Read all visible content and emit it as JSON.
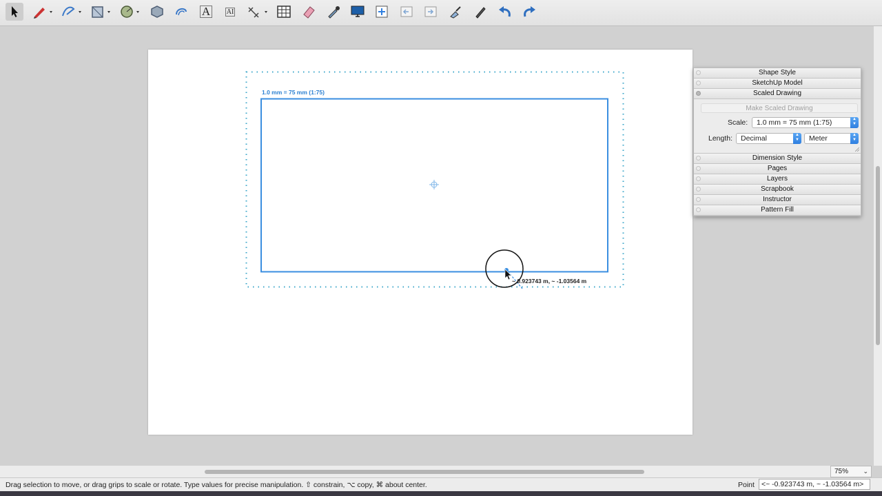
{
  "toolbar": {
    "tools": [
      {
        "id": "select",
        "icon": "arrow-select-icon",
        "active": true
      },
      {
        "id": "freehand",
        "icon": "pencil-freehand-icon"
      },
      {
        "id": "lines",
        "icon": "bezier-line-icon"
      },
      {
        "id": "rectangle",
        "icon": "rectangle-icon"
      },
      {
        "id": "circle",
        "icon": "circle-icon"
      },
      {
        "id": "polygon",
        "icon": "polygon-icon"
      },
      {
        "id": "offset",
        "icon": "offset-icon"
      },
      {
        "id": "text",
        "icon": "text-icon",
        "glyph": "A"
      },
      {
        "id": "label",
        "icon": "label-text-icon",
        "glyph": "AI"
      },
      {
        "id": "dimension",
        "icon": "dimension-icon"
      },
      {
        "id": "table",
        "icon": "table-icon"
      },
      {
        "id": "eraser",
        "icon": "eraser-icon"
      },
      {
        "id": "eyedropper",
        "icon": "eyedropper-icon"
      },
      {
        "id": "presentation",
        "icon": "monitor-icon"
      },
      {
        "id": "add-page",
        "icon": "add-page-icon"
      },
      {
        "id": "previous-page",
        "icon": "previous-page-icon"
      },
      {
        "id": "next-page",
        "icon": "next-page-icon"
      },
      {
        "id": "style",
        "icon": "style-brush-icon"
      },
      {
        "id": "pen",
        "icon": "pen-icon"
      },
      {
        "id": "undo",
        "icon": "undo-icon"
      },
      {
        "id": "redo",
        "icon": "redo-icon"
      }
    ]
  },
  "drawing": {
    "scale_label": "1.0 mm = 75 mm (1:75)",
    "coordinate_tooltip": "~ 0.923743 m, ~ -1.03564 m",
    "selection_color": "#2a7fd1"
  },
  "inspector": {
    "panels": [
      {
        "label": "Shape Style"
      },
      {
        "label": "SketchUp Model"
      },
      {
        "label": "Scaled Drawing",
        "open": true
      },
      {
        "label": "Dimension Style"
      },
      {
        "label": "Pages"
      },
      {
        "label": "Layers"
      },
      {
        "label": "Scrapbook"
      },
      {
        "label": "Instructor"
      },
      {
        "label": "Pattern Fill"
      }
    ],
    "scaled_drawing": {
      "make_button": "Make Scaled Drawing",
      "scale_label": "Scale:",
      "scale_value": "1.0 mm = 75 mm (1:75)",
      "length_label": "Length:",
      "length_format": "Decimal",
      "length_unit": "Meter"
    }
  },
  "zoom": {
    "value": "75%"
  },
  "status": {
    "message": "Drag selection to move, or drag grips to scale or rotate. Type values for precise manipulation. ⇧ constrain, ⌥ copy, ⌘ about center.",
    "vcb_label": "Point",
    "vcb_value": "<~ -0.923743 m, ~ -1.03564 m>"
  }
}
